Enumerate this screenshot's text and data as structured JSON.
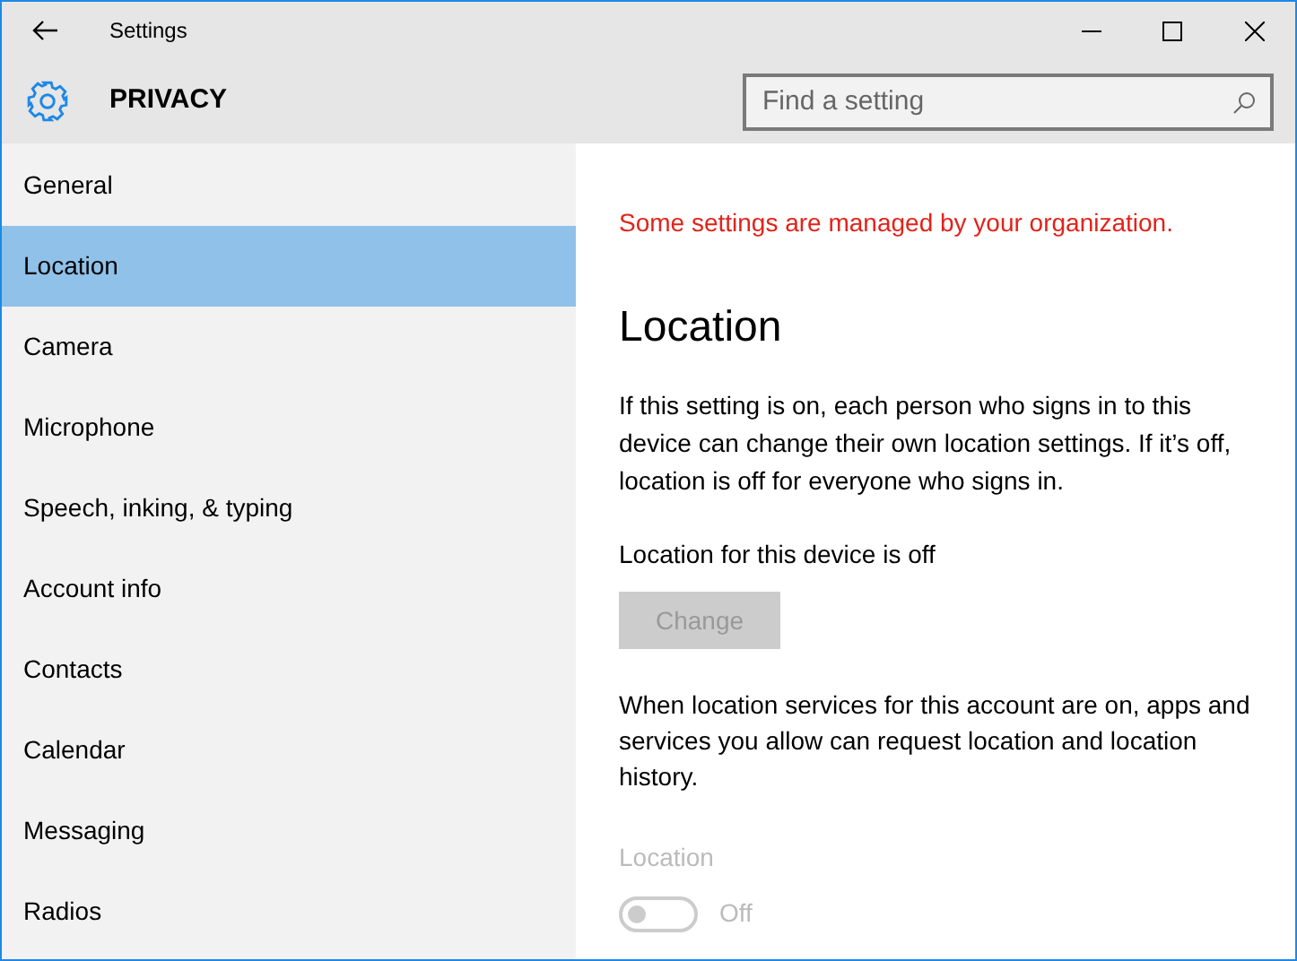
{
  "window": {
    "title": "Settings"
  },
  "header": {
    "title": "PRIVACY",
    "search": {
      "placeholder": "Find a setting"
    }
  },
  "sidebar": {
    "items": [
      {
        "label": "General",
        "selected": false
      },
      {
        "label": "Location",
        "selected": true
      },
      {
        "label": "Camera",
        "selected": false
      },
      {
        "label": "Microphone",
        "selected": false
      },
      {
        "label": "Speech, inking, & typing",
        "selected": false
      },
      {
        "label": "Account info",
        "selected": false
      },
      {
        "label": "Contacts",
        "selected": false
      },
      {
        "label": "Calendar",
        "selected": false
      },
      {
        "label": "Messaging",
        "selected": false
      },
      {
        "label": "Radios",
        "selected": false
      }
    ]
  },
  "content": {
    "notice": "Some settings are managed by your organization.",
    "heading": "Location",
    "description": "If this setting is on, each person who signs in to this device can change their own location settings. If it’s off, location is off for everyone who signs in.",
    "device_status": "Location for this device is off",
    "change_button": {
      "label": "Change",
      "disabled": true
    },
    "account_description": "When location services for this account are on, apps and services you allow can request location and location history.",
    "toggle": {
      "label": "Location",
      "on": false,
      "disabled": true,
      "state_text": "Off"
    }
  }
}
